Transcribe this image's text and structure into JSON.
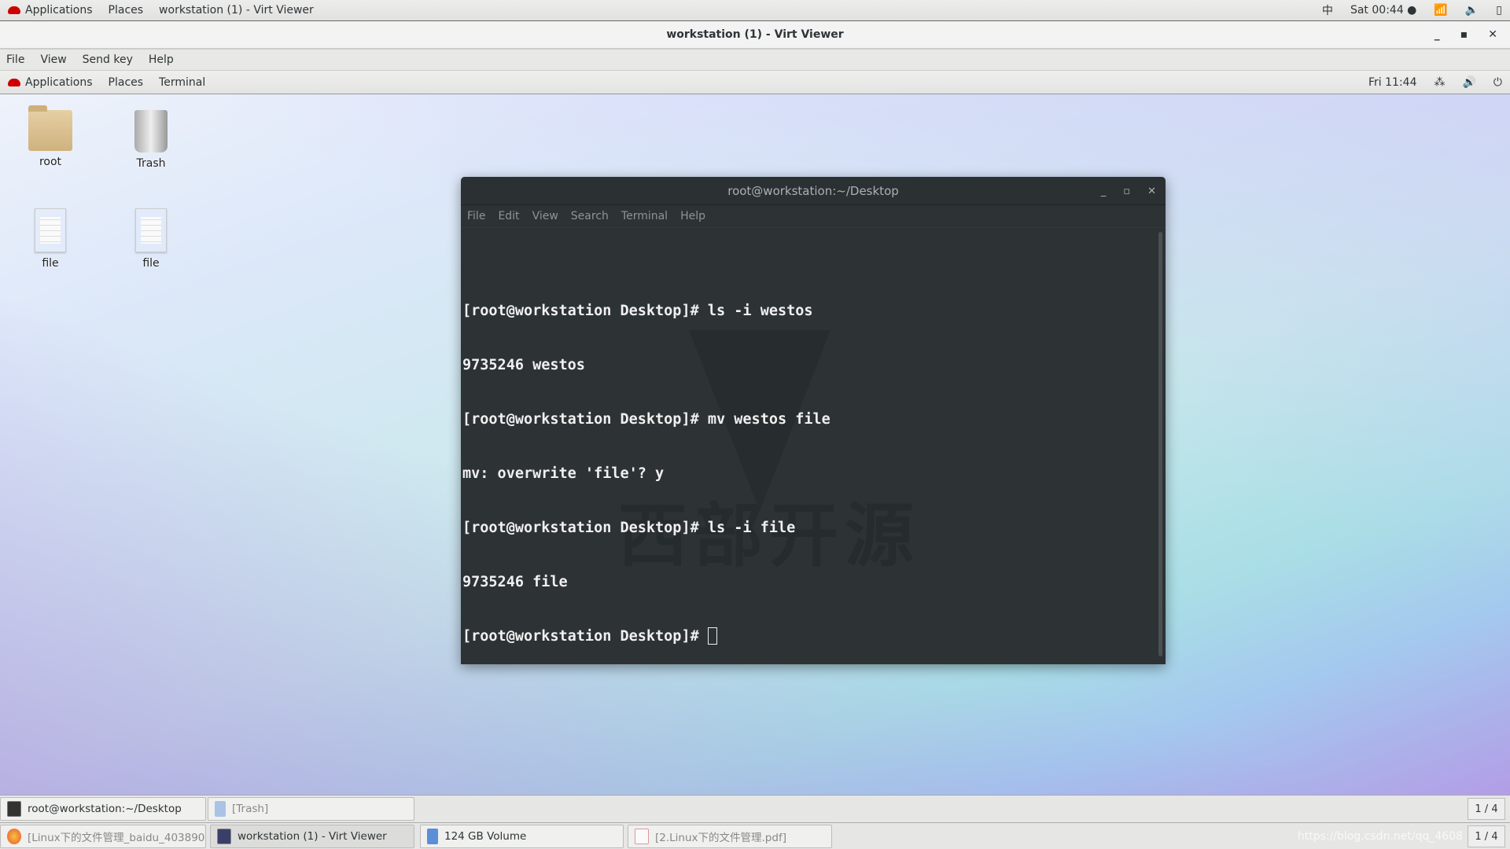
{
  "host_top": {
    "applications": "Applications",
    "places": "Places",
    "window": "workstation (1) - Virt Viewer",
    "input_method": "中",
    "clock": "Sat 00:44"
  },
  "viewer": {
    "title": "workstation (1) - Virt Viewer",
    "menu": [
      "File",
      "View",
      "Send key",
      "Help"
    ]
  },
  "guest_top": {
    "applications": "Applications",
    "places": "Places",
    "terminal": "Terminal",
    "clock": "Fri 11:44"
  },
  "desktop_icons": [
    {
      "label": "root",
      "icon": "home-folder-icon"
    },
    {
      "label": "Trash",
      "icon": "trash-icon"
    },
    {
      "label": "file",
      "icon": "text-file-icon"
    },
    {
      "label": "file",
      "icon": "text-file-icon"
    }
  ],
  "terminal": {
    "title": "root@workstation:~/Desktop",
    "menu": [
      "File",
      "Edit",
      "View",
      "Search",
      "Terminal",
      "Help"
    ],
    "lines": [
      "[root@workstation Desktop]# ls -i westos",
      "9735246 westos",
      "[root@workstation Desktop]# mv westos file",
      "mv: overwrite 'file'? y",
      "[root@workstation Desktop]# ls -i file",
      "9735246 file"
    ],
    "prompt": "[root@workstation Desktop]# ",
    "watermark": "西部开源"
  },
  "guest_taskbar": {
    "items": [
      "root@workstation:~/Desktop",
      "[Trash]"
    ],
    "pager": "1 / 4"
  },
  "host_taskbar": {
    "items": [
      "[Linux下的文件管理_baidu_403890...",
      "workstation (1) - Virt Viewer",
      "124 GB Volume",
      "[2.Linux下的文件管理.pdf]"
    ],
    "pager": "1 / 4",
    "watermark": "https://blog.csdn.net/qq_4608"
  }
}
